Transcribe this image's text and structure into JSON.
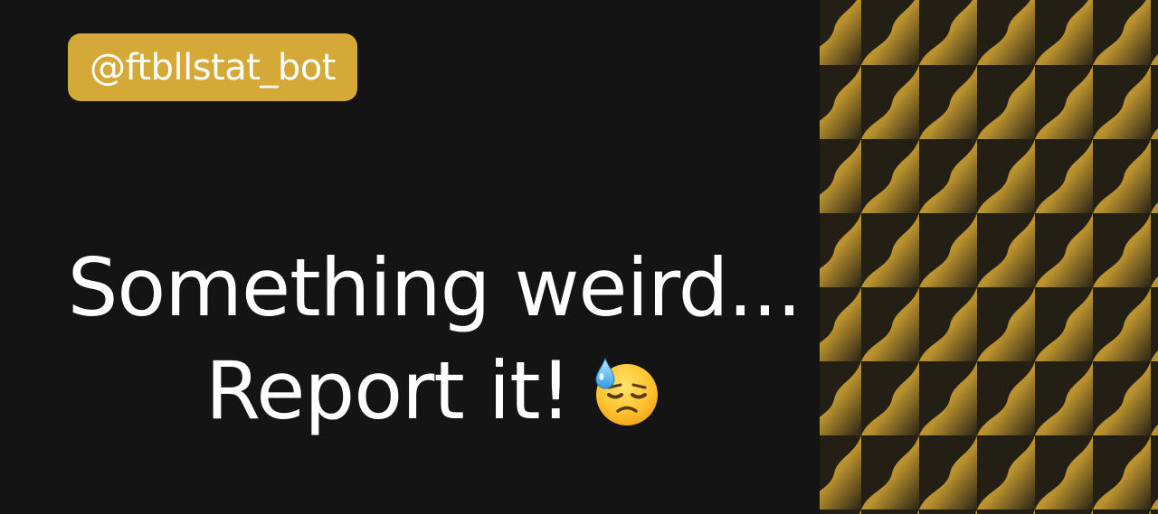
{
  "handle": {
    "text": "@ftbllstat_bot",
    "background_color": "#d4a937"
  },
  "message": {
    "line1": "Something weird...",
    "line2": "Report it!",
    "emoji_icon": "downcast-face-with-sweat-icon"
  },
  "theme": {
    "background_color": "#141414",
    "text_color": "#ffffff",
    "pattern_gold": "#d9ad3b",
    "pattern_dark": "#1e1a12"
  }
}
